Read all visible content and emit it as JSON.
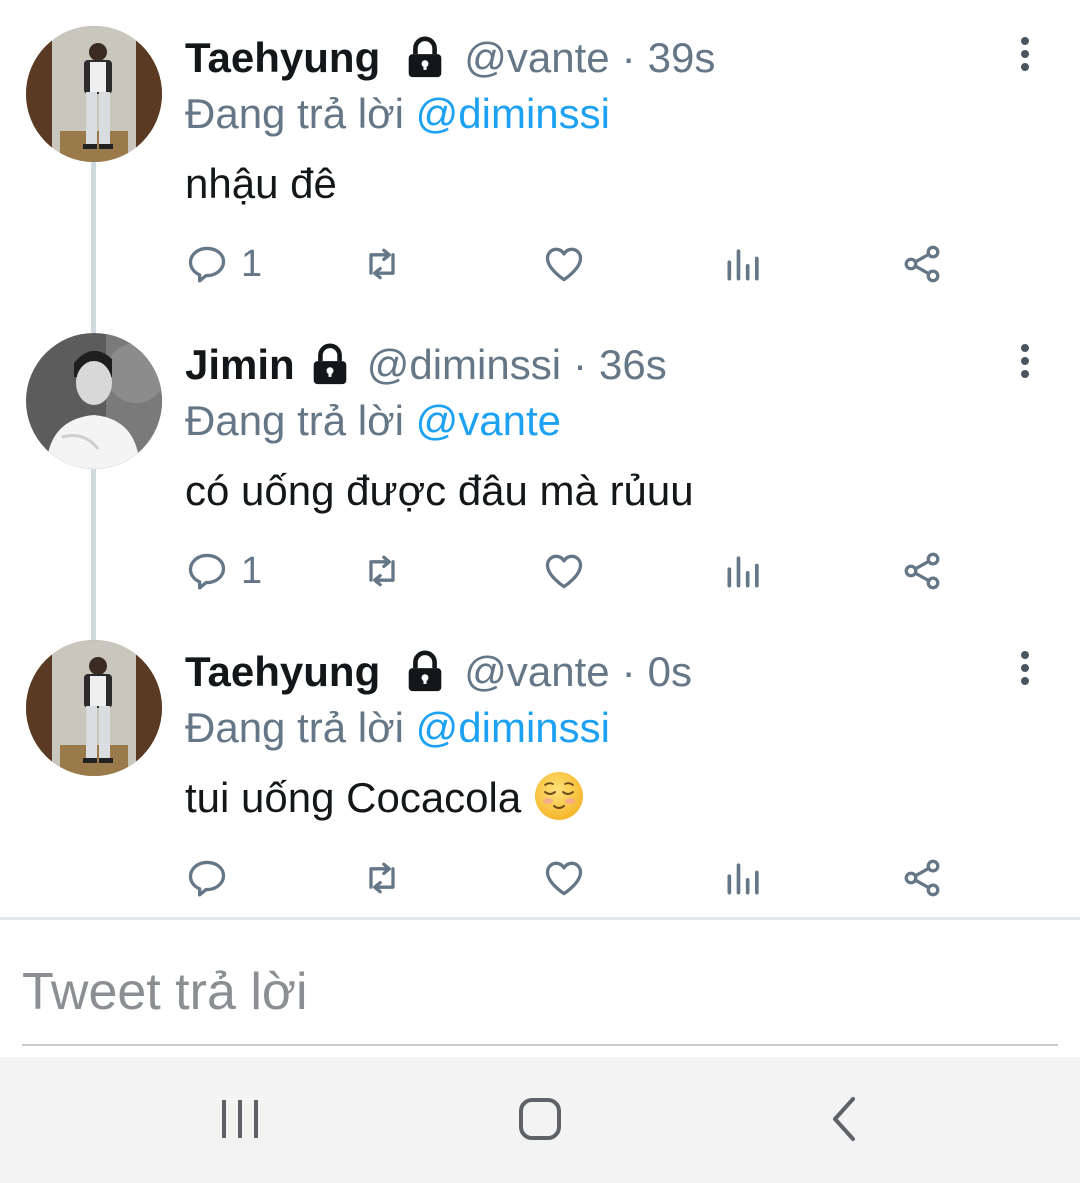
{
  "tweets": [
    {
      "name": "Taehyung",
      "handle": "@vante",
      "separator": "·",
      "time": "39s",
      "replying_label": "Đang trả lời",
      "replying_to": "@diminssi",
      "text": "nhậu đê",
      "reply_count": "1",
      "avatar": "taehyung-avatar",
      "protected": true
    },
    {
      "name": "Jimin",
      "handle": "@diminssi",
      "separator": "·",
      "time": "36s",
      "replying_label": "Đang trả lời",
      "replying_to": "@vante",
      "text": "có uống được đâu mà rủuu",
      "reply_count": "1",
      "avatar": "jimin-avatar",
      "protected": true
    },
    {
      "name": "Taehyung",
      "handle": "@vante",
      "separator": "·",
      "time": "0s",
      "replying_label": "Đang trả lời",
      "replying_to": "@diminssi",
      "text": "tui uống Cocacola",
      "emoji": "relieved-face-emoji",
      "reply_count": "",
      "avatar": "taehyung-avatar",
      "protected": true
    }
  ],
  "reply_box": {
    "placeholder": "Tweet trả lời"
  },
  "icons": {
    "lock": "lock-icon",
    "more": "more-vertical-icon",
    "reply": "reply-bubble-icon",
    "retweet": "retweet-icon",
    "like": "heart-icon",
    "stats": "analytics-icon",
    "share": "share-icon"
  },
  "navigation": [
    "recent-apps-icon",
    "home-icon",
    "back-icon"
  ],
  "colors": {
    "text": "#14171a",
    "secondary": "#657786",
    "link": "#1da1f2",
    "thread_line": "#cfd9de",
    "nav_bar": "#f3f3f3"
  }
}
